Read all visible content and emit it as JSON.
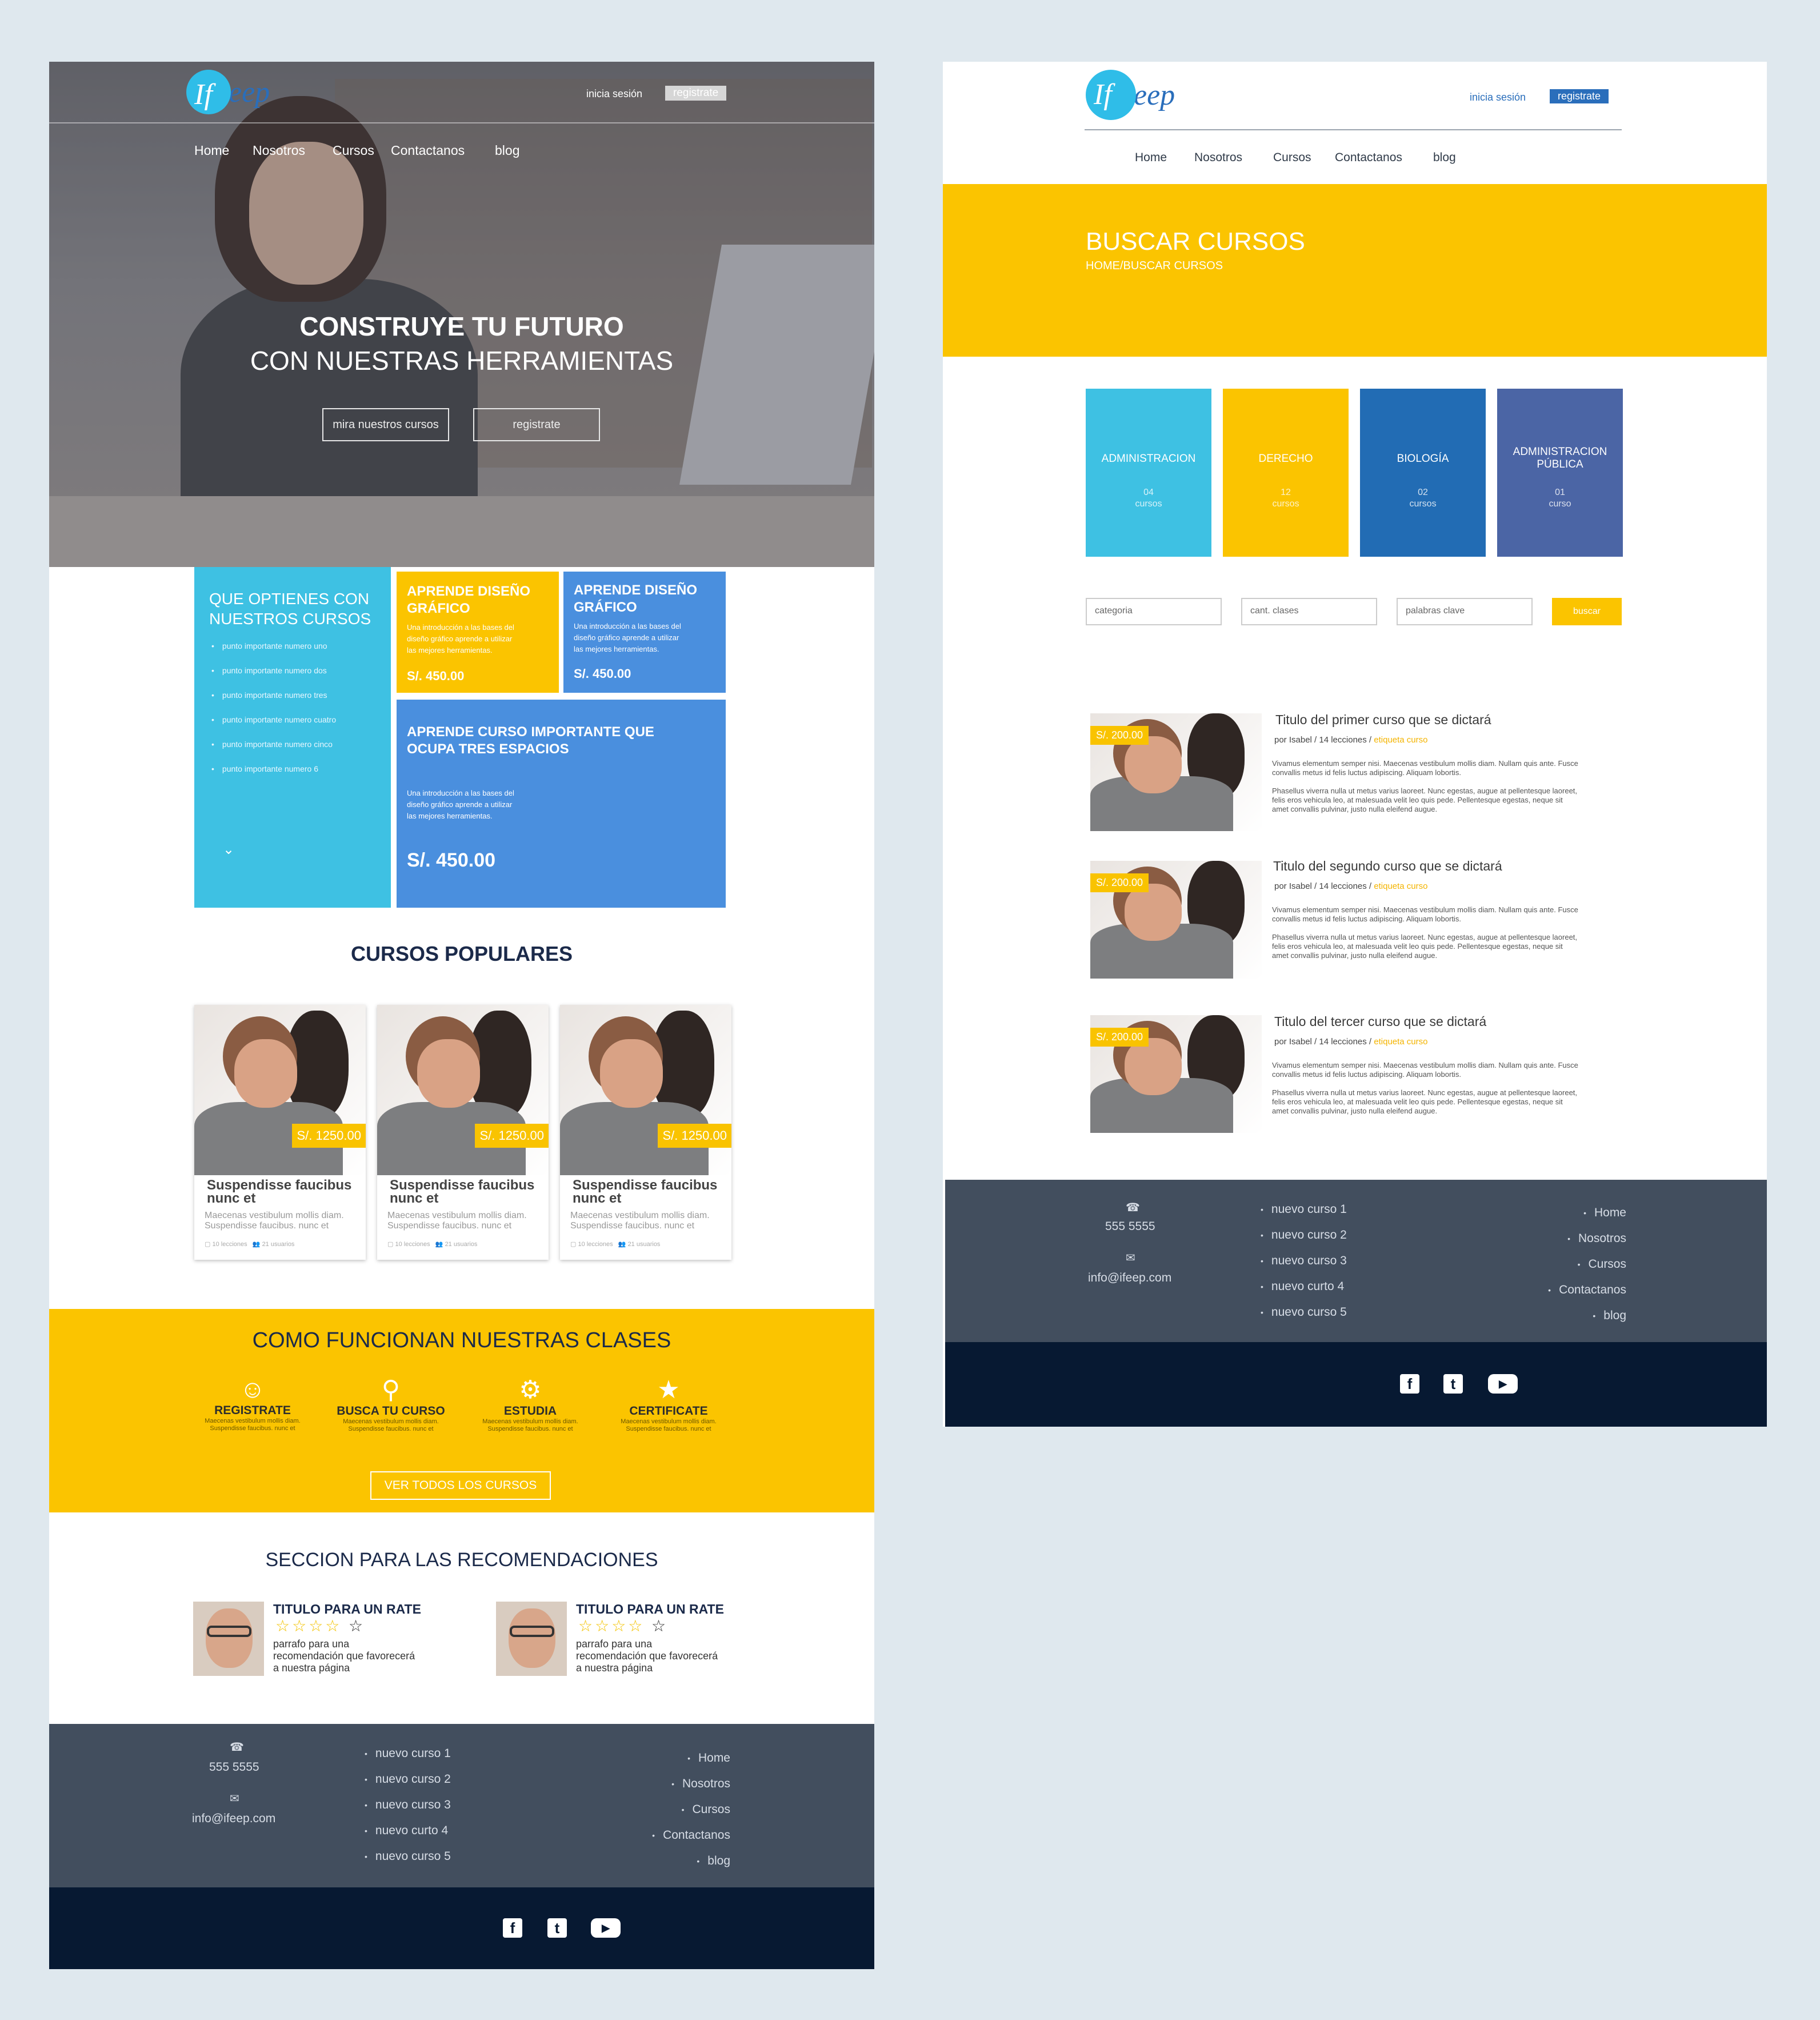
{
  "brand": {
    "logo_left": "If",
    "logo_right": "eep"
  },
  "pageA": {
    "header": {
      "login": "inicia sesión",
      "register": "registrate"
    },
    "nav": [
      "Home",
      "Nosotros",
      "Cursos",
      "Contactanos",
      "blog"
    ],
    "hero": {
      "title_bold": "CONSTRUYE TU FUTURO",
      "title_light": "CON NUESTRAS HERRAMIENTAS",
      "btn_courses": "mira nuestros cursos",
      "btn_register": "registrate"
    },
    "benefits": {
      "title": "QUE OPTIENES CON NUESTROS CURSOS",
      "items": [
        "punto importante numero uno",
        "punto importante numero dos",
        "punto importante numero tres",
        "punto importante numero cuatro",
        "punto importante numero cinco",
        "punto importante numero 6"
      ],
      "more": "⌄"
    },
    "offers": [
      {
        "title": "APRENDE DISEÑO GRÁFICO",
        "desc": "Una introducción a las bases del diseño gráfico aprende a utilizar las mejores herramientas.",
        "price": "S/. 450.00"
      },
      {
        "title": "APRENDE DISEÑO GRÁFICO",
        "desc": "Una introducción a las bases del diseño gráfico aprende a utilizar las mejores herramientas.",
        "price": "S/. 450.00"
      },
      {
        "title": "APRENDE CURSO IMPORTANTE QUE OCUPA TRES ESPACIOS",
        "desc": "Una introducción a las bases del diseño gráfico aprende a utilizar las mejores herramientas.",
        "price": "S/. 450.00"
      }
    ],
    "popular": {
      "title": "CURSOS POPULARES",
      "cards": [
        {
          "price": "S/. 1250.00",
          "title": "Suspendisse faucibus nunc et",
          "desc": "Maecenas vestibulum mollis diam. Suspendisse faucibus. nunc et",
          "lessons": "10 lecciones",
          "users": "21 usuarios"
        },
        {
          "price": "S/. 1250.00",
          "title": "Suspendisse faucibus nunc et",
          "desc": "Maecenas vestibulum mollis diam. Suspendisse faucibus. nunc et",
          "lessons": "10 lecciones",
          "users": "21 usuarios"
        },
        {
          "price": "S/. 1250.00",
          "title": "Suspendisse faucibus nunc et",
          "desc": "Maecenas vestibulum mollis diam. Suspendisse faucibus. nunc et",
          "lessons": "10 lecciones",
          "users": "21 usuarios"
        }
      ]
    },
    "how": {
      "title": "COMO FUNCIONAN NUESTRAS CLASES",
      "steps": [
        {
          "title": "REGISTRATE",
          "desc": "Maecenas vestibulum mollis diam. Suspendisse faucibus. nunc et"
        },
        {
          "title": "BUSCA TU CURSO",
          "desc": "Maecenas vestibulum mollis diam. Suspendisse faucibus. nunc et"
        },
        {
          "title": "ESTUDIA",
          "desc": "Maecenas vestibulum mollis diam. Suspendisse faucibus. nunc et"
        },
        {
          "title": "CERTIFICATE",
          "desc": "Maecenas vestibulum mollis diam. Suspendisse faucibus. nunc et"
        }
      ],
      "cta": "VER TODOS LOS CURSOS"
    },
    "recs": {
      "title": "SECCION PARA LAS RECOMENDACIONES",
      "items": [
        {
          "title": "TITULO PARA UN RATE",
          "stars": "☆☆☆☆",
          "empty": "☆",
          "text": "parrafo para una recomendación que favorecerá a nuestra página"
        },
        {
          "title": "TITULO PARA UN RATE",
          "stars": "☆☆☆☆",
          "empty": "☆",
          "text": "parrafo para una recomendación que favorecerá a nuestra página"
        }
      ]
    }
  },
  "footer": {
    "phone_icon": "☎",
    "phone": "555  5555",
    "mail_icon": "✉",
    "email": "info@ifeep.com",
    "courses": [
      "nuevo curso 1",
      "nuevo curso 2",
      "nuevo curso 3",
      "nuevo curto 4",
      "nuevo curso 5"
    ],
    "links": [
      "Home",
      "Nosotros",
      "Cursos",
      "Contactanos",
      "blog"
    ],
    "social": {
      "facebook": "f",
      "twitter": "t",
      "youtube": "▶"
    }
  },
  "pageB": {
    "header": {
      "login": "inicia sesión",
      "register": "registrate"
    },
    "nav": [
      "Home",
      "Nosotros",
      "Cursos",
      "Contactanos",
      "blog"
    ],
    "banner": {
      "title": "BUSCAR CURSOS",
      "crumb": "HOME/BUSCAR CURSOS"
    },
    "categories": [
      {
        "name": "ADMINISTRACION",
        "count": "04",
        "unit": "cursos",
        "color": "#3ec1e3"
      },
      {
        "name": "DERECHO",
        "count": "12",
        "unit": "cursos",
        "color": "#fbc400"
      },
      {
        "name": "BIOLOGÍA",
        "count": "02",
        "unit": "cursos",
        "color": "#226cb4"
      },
      {
        "name": "ADMINISTRACION PÚBLICA",
        "count": "01",
        "unit": "curso",
        "color": "#4b65a5"
      }
    ],
    "search": {
      "category": "categoria",
      "classes": "cant. clases",
      "keywords": "palabras clave",
      "button": "buscar"
    },
    "results": [
      {
        "price": "S/. 200.00",
        "title": "Titulo del primer curso que se dictará",
        "by": "por Isabel / 14 lecciones / ",
        "tag": "etiqueta curso",
        "p1": "Vivamus elementum semper nisi. Maecenas vestibulum mollis diam. Nullam quis ante. Fusce convallis metus id felis luctus adipiscing. Aliquam lobortis.",
        "p2": "Phasellus viverra nulla ut metus varius laoreet. Nunc egestas, augue at pellentesque laoreet, felis eros vehicula leo, at malesuada velit leo quis pede. Pellentesque egestas, neque sit amet convallis pulvinar, justo nulla eleifend augue."
      },
      {
        "price": "S/. 200.00",
        "title": "Titulo del segundo curso que se dictará",
        "by": "por Isabel / 14 lecciones / ",
        "tag": "etiqueta curso",
        "p1": "Vivamus elementum semper nisi. Maecenas vestibulum mollis diam. Nullam quis ante. Fusce convallis metus id felis luctus adipiscing. Aliquam lobortis.",
        "p2": "Phasellus viverra nulla ut metus varius laoreet. Nunc egestas, augue at pellentesque laoreet, felis eros vehicula leo, at malesuada velit leo quis pede. Pellentesque egestas, neque sit amet convallis pulvinar, justo nulla eleifend augue."
      },
      {
        "price": "S/. 200.00",
        "title": "Titulo del tercer curso que se dictará",
        "by": "por Isabel / 14 lecciones / ",
        "tag": "etiqueta curso",
        "p1": "Vivamus elementum semper nisi. Maecenas vestibulum mollis diam. Nullam quis ante. Fusce convallis metus id felis luctus adipiscing. Aliquam lobortis.",
        "p2": "Phasellus viverra nulla ut metus varius laoreet. Nunc egestas, augue at pellentesque laoreet, felis eros vehicula leo, at malesuada velit leo quis pede. Pellentesque egestas, neque sit amet convallis pulvinar, justo nulla eleifend augue."
      }
    ]
  },
  "colors": {
    "yellow": "#fbc400",
    "cyan": "#3ec1e3",
    "blue": "#4a8fde",
    "navy": "#071932",
    "slate": "#424e5e"
  }
}
